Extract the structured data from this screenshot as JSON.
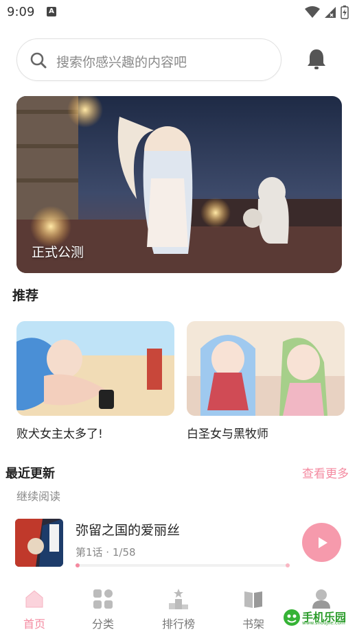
{
  "status_bar": {
    "time": "9:09",
    "notification_glyph": "A"
  },
  "search": {
    "placeholder": "搜索你感兴趣的内容吧"
  },
  "banner": {
    "caption": "正式公测"
  },
  "recommend": {
    "title": "推荐",
    "items": [
      {
        "title": "败犬女主太多了!"
      },
      {
        "title": "白圣女与黑牧师"
      }
    ]
  },
  "recent": {
    "title": "最近更新",
    "more_label": "查看更多",
    "subtitle": "继续阅读",
    "item": {
      "name": "弥留之国的爱丽丝",
      "progress_text": "第1话 · 1/58",
      "progress": 0.017
    }
  },
  "bottom_nav": {
    "items": [
      {
        "label": "首页",
        "icon": "home-icon",
        "active": true
      },
      {
        "label": "分类",
        "icon": "grid-icon"
      },
      {
        "label": "排行榜",
        "icon": "podium-icon"
      },
      {
        "label": "书架",
        "icon": "book-icon"
      },
      {
        "label": "我的",
        "icon": "profile-icon"
      }
    ]
  },
  "colors": {
    "accent": "#f48aa0",
    "play_button": "#f69aac"
  }
}
